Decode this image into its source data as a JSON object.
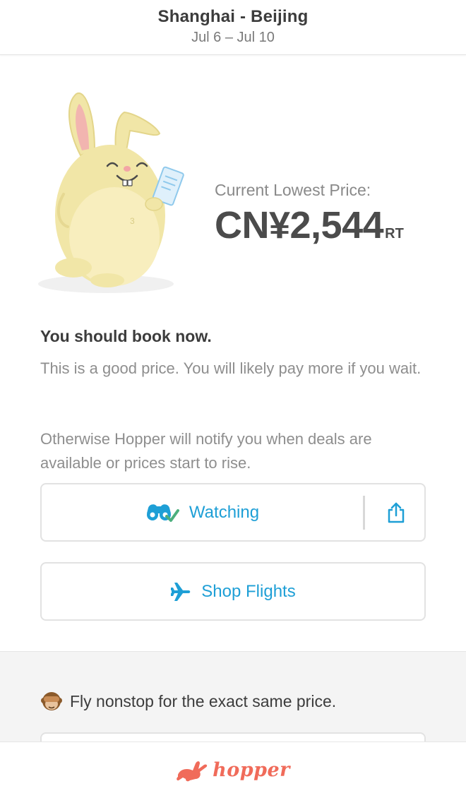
{
  "header": {
    "route": "Shanghai - Beijing",
    "dates": "Jul 6 – Jul 10"
  },
  "price": {
    "label": "Current Lowest Price:",
    "value": "CN¥2,544",
    "suffix": "RT"
  },
  "recommendation": {
    "headline": "You should book now.",
    "detail": "This is a good price. You will likely pay more if you wait.",
    "notify": "Otherwise Hopper will notify you when deals are available or prices start to rise."
  },
  "buttons": {
    "watching_label": "Watching",
    "shop_label": "Shop Flights"
  },
  "promo": {
    "text": "Fly nonstop for the exact same price."
  },
  "footer": {
    "brand": "hopper"
  },
  "icons": {
    "watch": "binoculars-check-icon",
    "share": "share-icon",
    "shop": "airplane-icon",
    "promo": "see-no-evil-monkey-icon",
    "logo": "bunny-logo-icon"
  },
  "colors": {
    "accent": "#1e9fd6",
    "check": "#4caf7d",
    "brand": "#f06b5a",
    "text": "#3c3c3c",
    "muted": "#8e8e8e"
  }
}
